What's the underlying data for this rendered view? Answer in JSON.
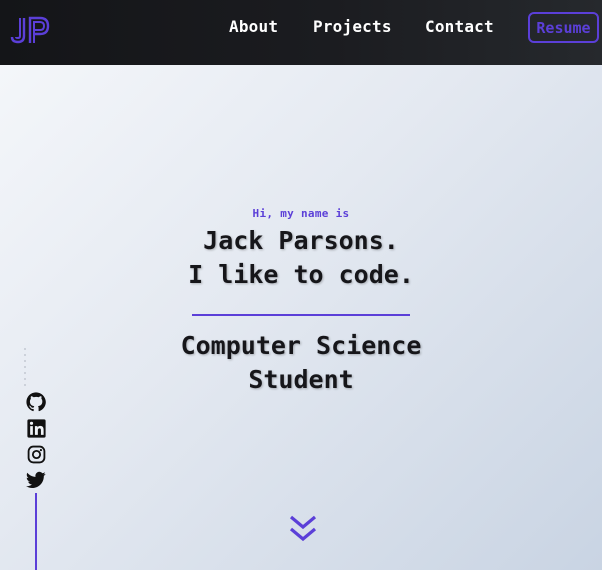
{
  "navbar": {
    "logo_text": "JP",
    "links": [
      "About",
      "Projects",
      "Contact"
    ],
    "resume_label": "Resume"
  },
  "hero": {
    "greeting": "Hi, my name is",
    "name_lines": [
      "Jack Parsons.",
      "I like to code."
    ],
    "role_lines": [
      "Computer Science",
      "Student"
    ]
  },
  "social": {
    "icons": [
      "github-icon",
      "linkedin-icon",
      "instagram-icon",
      "twitter-icon"
    ]
  },
  "colors": {
    "accent": "#5b3fd8",
    "navbar_bg": "#1b1c20",
    "text": "#16161a"
  }
}
